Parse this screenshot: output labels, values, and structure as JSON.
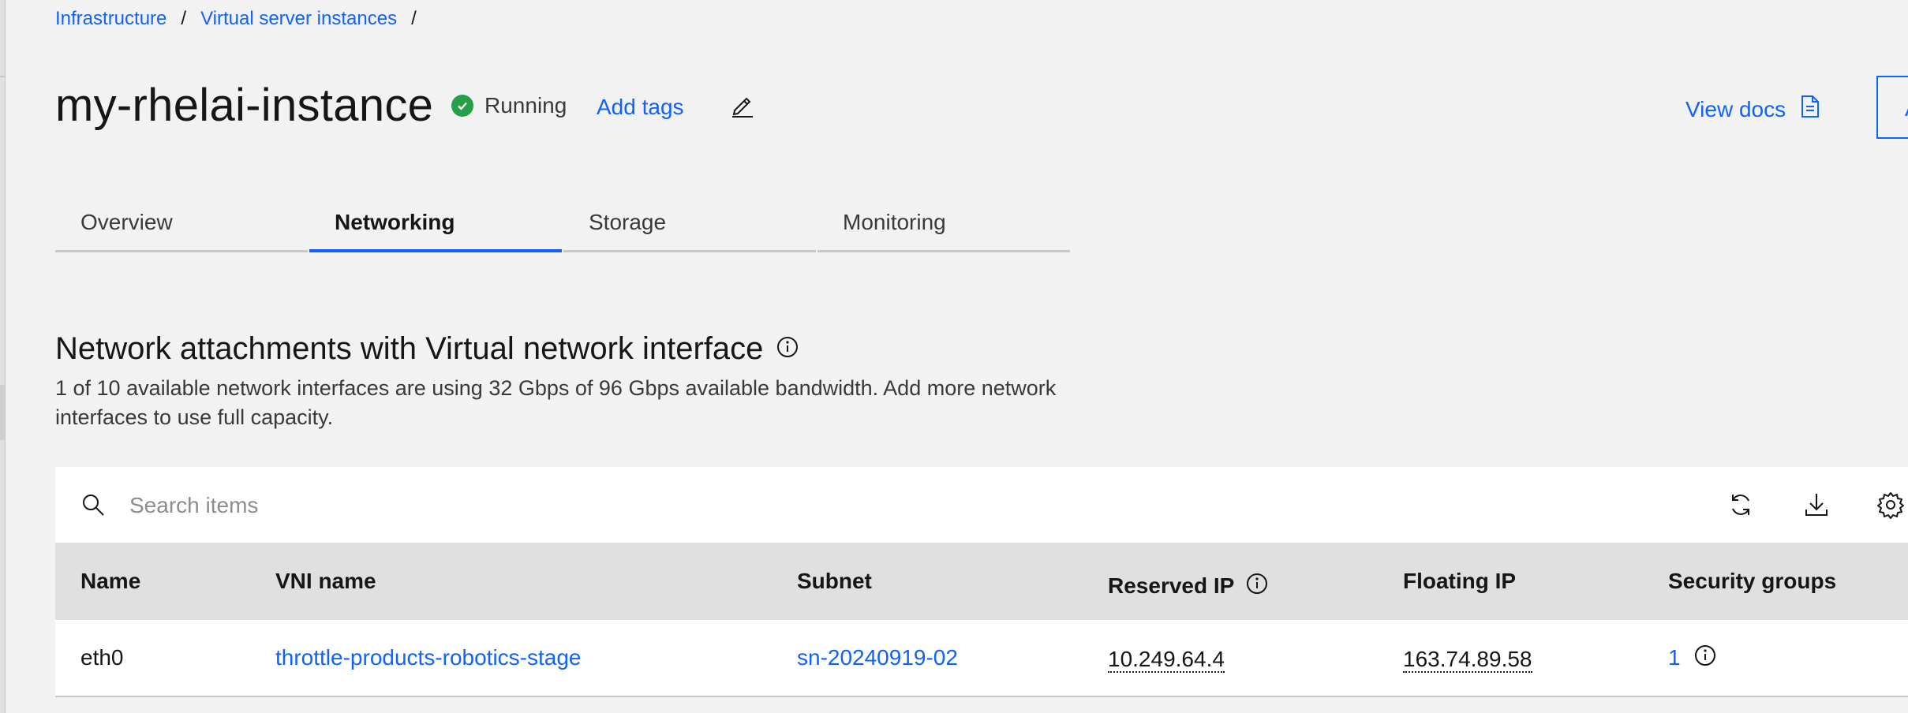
{
  "breadcrumb": {
    "items": [
      "Infrastructure",
      "Virtual server instances"
    ],
    "separator": "/"
  },
  "header": {
    "title": "my-rhelai-instance",
    "status": "Running",
    "add_tags": "Add tags",
    "view_docs": "View docs",
    "action_partial": "A"
  },
  "tabs": [
    {
      "label": "Overview",
      "active": false
    },
    {
      "label": "Networking",
      "active": true
    },
    {
      "label": "Storage",
      "active": false
    },
    {
      "label": "Monitoring",
      "active": false
    }
  ],
  "section": {
    "title": "Network attachments with Virtual network interface",
    "description": "1 of 10 available network interfaces are using 32 Gbps of 96 Gbps available bandwidth. Add more network interfaces to use full capacity."
  },
  "table": {
    "search_placeholder": "Search items",
    "columns": [
      "Name",
      "VNI name",
      "Subnet",
      "Reserved IP",
      "Floating IP",
      "Security groups"
    ],
    "rows": [
      {
        "name": "eth0",
        "vni_name": "throttle-products-robotics-stage",
        "subnet": "sn-20240919-02",
        "reserved_ip": "10.249.64.4",
        "floating_ip": "163.74.89.58",
        "security_groups": "1"
      }
    ]
  },
  "colors": {
    "accent": "#0f62fe",
    "status_green": "#24a148",
    "background": "#f2f2f2",
    "table_header": "#e0e0e0"
  },
  "icons": [
    "check-circle-icon",
    "edit-icon",
    "document-icon",
    "info-icon",
    "search-icon",
    "refresh-icon",
    "download-icon",
    "settings-icon"
  ]
}
